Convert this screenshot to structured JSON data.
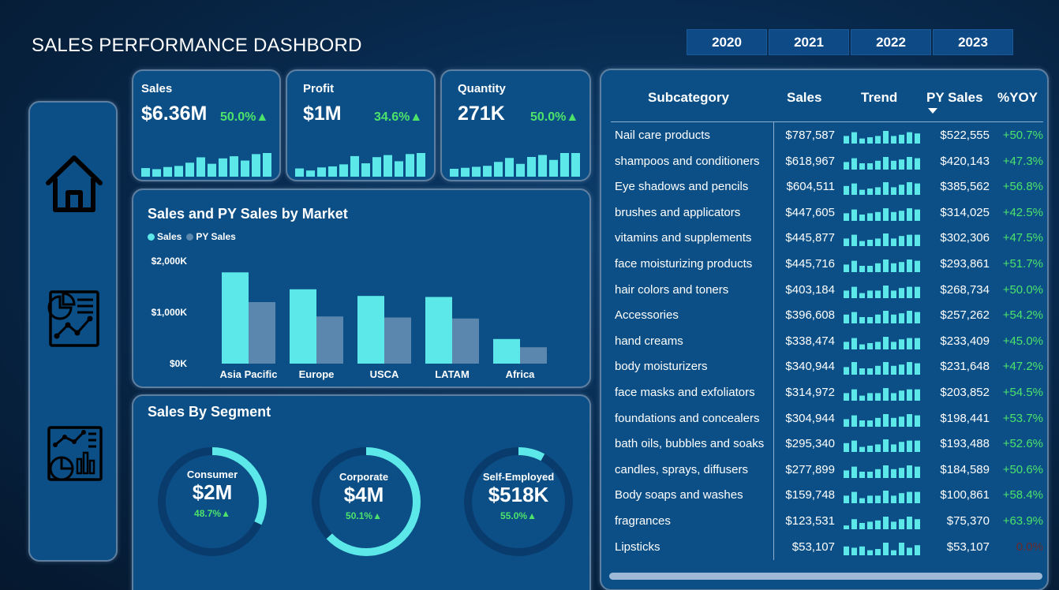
{
  "title": "SALES PERFORMANCE DASHBORD",
  "years": [
    "2020",
    "2021",
    "2022",
    "2023"
  ],
  "colors": {
    "accent": "#5ce8e8",
    "py": "#5b86ad",
    "positive": "#4de36b",
    "panel": "#0b4f86"
  },
  "nav": {
    "icons": [
      "home-icon",
      "report-icon",
      "analytics-icon"
    ]
  },
  "kpis": [
    {
      "label": "Sales",
      "value": "$6.36M",
      "pct": "50.0%▲",
      "spark": [
        8,
        7,
        9,
        10,
        13,
        18,
        12,
        17,
        19,
        15,
        21,
        22
      ]
    },
    {
      "label": "Profit",
      "value": "$1M",
      "pct": "34.6%▲",
      "spark": [
        8,
        6,
        9,
        10,
        12,
        20,
        13,
        19,
        21,
        15,
        22,
        23
      ]
    },
    {
      "label": "Quantity",
      "value": "271K",
      "pct": "50.0%▲",
      "spark": [
        8,
        9,
        10,
        11,
        15,
        19,
        13,
        20,
        22,
        17,
        24,
        24
      ]
    }
  ],
  "market": {
    "title": "Sales and PY Sales by Market",
    "legend": [
      "Sales",
      "PY Sales"
    ]
  },
  "segment": {
    "title": "Sales By Segment",
    "items": [
      {
        "name": "Consumer",
        "value": "$2M",
        "pct": "48.7%▲",
        "share": 0.32
      },
      {
        "name": "Corporate",
        "value": "$4M",
        "pct": "50.1%▲",
        "share": 0.63
      },
      {
        "name": "Self-Employed",
        "value": "$518K",
        "pct": "55.0%▲",
        "share": 0.08
      }
    ]
  },
  "chart_data": {
    "type": "bar",
    "categories": [
      "Asia Pacific",
      "Europe",
      "USCA",
      "LATAM",
      "Africa"
    ],
    "series": [
      {
        "name": "Sales",
        "values": [
          1780,
          1450,
          1320,
          1300,
          480
        ]
      },
      {
        "name": "PY Sales",
        "values": [
          1200,
          920,
          900,
          880,
          320
        ]
      }
    ],
    "yticks": [
      "$0K",
      "$1,000K",
      "$2,000K"
    ],
    "ylim": [
      0,
      2000
    ],
    "title": "Sales and PY Sales by Market",
    "legend_position": "top-left"
  },
  "table": {
    "headers": {
      "subcategory": "Subcategory",
      "sales": "Sales",
      "trend": "Trend",
      "py": "PY Sales",
      "yoy": "%YOY"
    },
    "rows": [
      {
        "sub": "Nail care products",
        "sales": "$787,587",
        "py": "$522,555",
        "yoy": "+50.7%",
        "trend": [
          6,
          9,
          4,
          5,
          6,
          10,
          6,
          7,
          9,
          8
        ]
      },
      {
        "sub": "shampoos and conditioners",
        "sales": "$618,967",
        "py": "$420,143",
        "yoy": "+47.3%",
        "trend": [
          6,
          9,
          5,
          5,
          7,
          10,
          7,
          8,
          10,
          9
        ]
      },
      {
        "sub": "Eye shadows and pencils",
        "sales": "$604,511",
        "py": "$385,562",
        "yoy": "+56.8%",
        "trend": [
          7,
          9,
          4,
          5,
          6,
          10,
          6,
          8,
          10,
          9
        ]
      },
      {
        "sub": "brushes and applicators",
        "sales": "$447,605",
        "py": "$314,025",
        "yoy": "+42.5%",
        "trend": [
          6,
          9,
          5,
          6,
          7,
          10,
          7,
          8,
          10,
          9
        ]
      },
      {
        "sub": "vitamins and supplements",
        "sales": "$445,877",
        "py": "$302,306",
        "yoy": "+47.5%",
        "trend": [
          6,
          9,
          4,
          5,
          6,
          10,
          6,
          8,
          9,
          9
        ]
      },
      {
        "sub": "face moisturizing products",
        "sales": "$445,716",
        "py": "$293,861",
        "yoy": "+51.7%",
        "trend": [
          6,
          9,
          5,
          5,
          7,
          10,
          7,
          8,
          10,
          9
        ]
      },
      {
        "sub": "hair colors and toners",
        "sales": "$403,184",
        "py": "$268,734",
        "yoy": "+50.0%",
        "trend": [
          6,
          9,
          4,
          6,
          6,
          10,
          6,
          8,
          9,
          9
        ]
      },
      {
        "sub": "Accessories",
        "sales": "$396,608",
        "py": "$257,262",
        "yoy": "+54.2%",
        "trend": [
          7,
          9,
          5,
          5,
          7,
          10,
          7,
          8,
          10,
          9
        ]
      },
      {
        "sub": "hand creams",
        "sales": "$338,474",
        "py": "$233,409",
        "yoy": "+45.0%",
        "trend": [
          6,
          9,
          4,
          5,
          6,
          10,
          6,
          8,
          9,
          9
        ]
      },
      {
        "sub": "body moisturizers",
        "sales": "$340,944",
        "py": "$231,648",
        "yoy": "+47.2%",
        "trend": [
          6,
          10,
          5,
          5,
          7,
          10,
          7,
          8,
          10,
          9
        ]
      },
      {
        "sub": "face masks and exfoliators",
        "sales": "$314,972",
        "py": "$203,852",
        "yoy": "+54.5%",
        "trend": [
          6,
          9,
          4,
          6,
          6,
          10,
          6,
          8,
          9,
          9
        ]
      },
      {
        "sub": "foundations and concealers",
        "sales": "$304,944",
        "py": "$198,441",
        "yoy": "+53.7%",
        "trend": [
          6,
          9,
          5,
          5,
          7,
          10,
          7,
          8,
          10,
          9
        ]
      },
      {
        "sub": "bath oils, bubbles and soaks",
        "sales": "$295,340",
        "py": "$193,488",
        "yoy": "+52.6%",
        "trend": [
          7,
          9,
          4,
          5,
          6,
          10,
          6,
          8,
          9,
          9
        ]
      },
      {
        "sub": "candles, sprays, diffusers",
        "sales": "$277,899",
        "py": "$184,589",
        "yoy": "+50.6%",
        "trend": [
          6,
          9,
          5,
          5,
          7,
          10,
          7,
          8,
          10,
          9
        ]
      },
      {
        "sub": "Body soaps and washes",
        "sales": "$159,748",
        "py": "$100,861",
        "yoy": "+58.4%",
        "trend": [
          6,
          9,
          4,
          6,
          6,
          10,
          6,
          8,
          9,
          9
        ]
      },
      {
        "sub": "fragrances",
        "sales": "$123,531",
        "py": "$75,370",
        "yoy": "+63.9%",
        "trend": [
          3,
          8,
          5,
          6,
          7,
          10,
          6,
          8,
          10,
          8
        ]
      },
      {
        "sub": "Lipsticks",
        "sales": "$53,107",
        "py": "$53,107",
        "yoy": "0.0%",
        "trend": [
          7,
          6,
          7,
          4,
          5,
          10,
          4,
          10,
          6,
          8
        ]
      }
    ]
  }
}
